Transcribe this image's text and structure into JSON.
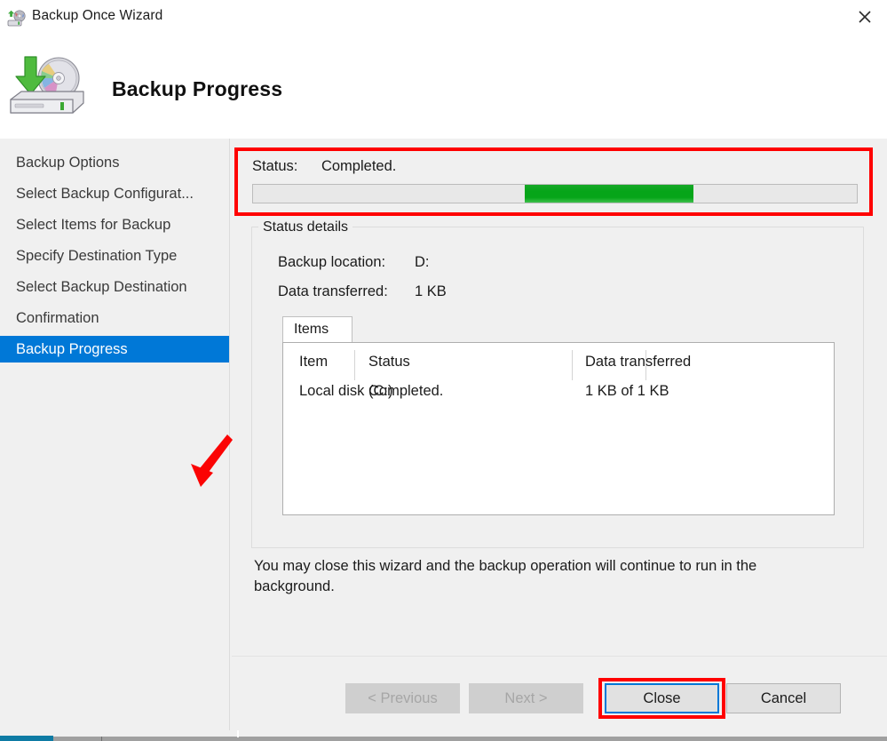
{
  "window": {
    "title": "Backup Once Wizard",
    "title_icon": "backup-wizard-icon",
    "close_icon": "close-icon"
  },
  "header": {
    "title": "Backup Progress",
    "icon": "backup-disk-icon"
  },
  "sidebar": {
    "items": [
      {
        "label": "Backup Options",
        "active": false
      },
      {
        "label": "Select Backup Configurat...",
        "active": false
      },
      {
        "label": "Select Items for Backup",
        "active": false
      },
      {
        "label": "Specify Destination Type",
        "active": false
      },
      {
        "label": "Select Backup Destination",
        "active": false
      },
      {
        "label": "Confirmation",
        "active": false
      },
      {
        "label": "Backup Progress",
        "active": true
      }
    ],
    "active_color": "#0078d7"
  },
  "annotations": {
    "arrow_color": "#ff0000",
    "arrow_target": "Backup Progress",
    "highlight_color": "#ff0000"
  },
  "status": {
    "label": "Status:",
    "value": "Completed.",
    "progress": {
      "chunk_left_pct": 45.0,
      "chunk_width_pct": 28.0,
      "bar_color": "#06a519",
      "track_color": "#e8e8e8",
      "indeterminate": true
    }
  },
  "status_details": {
    "legend": "Status details",
    "rows": [
      {
        "label": "Backup location:",
        "value": "D:"
      },
      {
        "label": "Data transferred:",
        "value": "1 KB"
      }
    ],
    "tabs": [
      {
        "label": "Items",
        "selected": true
      }
    ],
    "table": {
      "columns": [
        "Item",
        "Status",
        "Data transferred",
        ""
      ],
      "rows": [
        [
          "Local disk (C:)",
          "Completed.",
          "1 KB of 1 KB",
          ""
        ]
      ]
    }
  },
  "note": "You may close this wizard and the backup operation will continue to run in the background.",
  "footer": {
    "buttons": [
      {
        "label": "< Previous",
        "state": "disabled"
      },
      {
        "label": "Next >",
        "state": "disabled"
      },
      {
        "label": "Close",
        "state": "default-focused"
      },
      {
        "label": "Cancel",
        "state": "enabled"
      }
    ]
  },
  "taskbar": {
    "accent_color": "#0e7ba4"
  }
}
